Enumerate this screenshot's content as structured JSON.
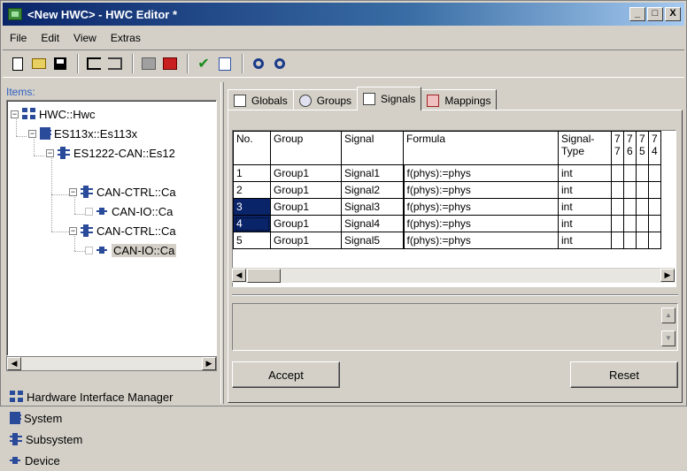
{
  "window": {
    "title": "<New HWC> - HWC Editor  *",
    "minimize": "_",
    "maximize": "□",
    "close": "X"
  },
  "menu": [
    "File",
    "Edit",
    "View",
    "Extras"
  ],
  "toolbar": {
    "icons": [
      "new-icon",
      "open-folder-icon",
      "save-icon",
      "tree-expand-icon",
      "tree-collapse-icon",
      "add-disabled-icon",
      "add-red-icon",
      "check-icon",
      "document-icon",
      "find-icon",
      "find-next-icon"
    ]
  },
  "left": {
    "items_label": "Items:",
    "tree": [
      {
        "label": "HWC::Hwc",
        "icon": "hwc-icon",
        "level": 0
      },
      {
        "label": "ES113x::Es113x",
        "icon": "system-icon",
        "level": 1
      },
      {
        "label": "ES1222-CAN::Es12",
        "icon": "subsystem-icon",
        "level": 2
      },
      {
        "label": "CAN-CTRL::Ca",
        "icon": "subsystem-icon",
        "level": 3
      },
      {
        "label": "CAN-IO::Ca",
        "icon": "device-icon",
        "level": 4
      },
      {
        "label": "CAN-CTRL::Ca",
        "icon": "subsystem-icon",
        "level": 3
      },
      {
        "label": "CAN-IO::Ca",
        "icon": "device-icon",
        "level": 4
      }
    ],
    "legend": [
      {
        "label": "Hardware Interface Manager",
        "icon": "hwc-icon"
      },
      {
        "label": "System",
        "icon": "system-icon"
      },
      {
        "label": "Subsystem",
        "icon": "subsystem-icon"
      },
      {
        "label": "Device",
        "icon": "device-icon"
      }
    ]
  },
  "tabs": [
    {
      "label": "Globals",
      "icon": "globals-icon"
    },
    {
      "label": "Groups",
      "icon": "groups-icon"
    },
    {
      "label": "Signals",
      "icon": "signals-icon",
      "active": true
    },
    {
      "label": "Mappings",
      "icon": "mappings-icon"
    }
  ],
  "grid": {
    "headers": [
      "No.",
      "Group",
      "Signal",
      "Formula",
      "Signal-\nType",
      "7\n7",
      "7\n6",
      "7\n5",
      "7\n4"
    ],
    "rows": [
      [
        "1",
        "Group1",
        "Signal1",
        "f(phys):=phys",
        "int",
        "",
        "",
        "",
        ""
      ],
      [
        "2",
        "Group1",
        "Signal2",
        "f(phys):=phys",
        "int",
        "",
        "",
        "",
        ""
      ],
      [
        "3",
        "Group1",
        "Signal3",
        "f(phys):=phys",
        "int",
        "",
        "",
        "",
        ""
      ],
      [
        "4",
        "Group1",
        "Signal4",
        "f(phys):=phys",
        "int",
        "",
        "",
        "",
        ""
      ],
      [
        "5",
        "Group1",
        "Signal5",
        "f(phys):=phys",
        "int",
        "",
        "",
        "",
        ""
      ]
    ],
    "selected_rows": [
      3,
      4
    ]
  },
  "buttons": {
    "accept": "Accept",
    "reset": "Reset"
  }
}
